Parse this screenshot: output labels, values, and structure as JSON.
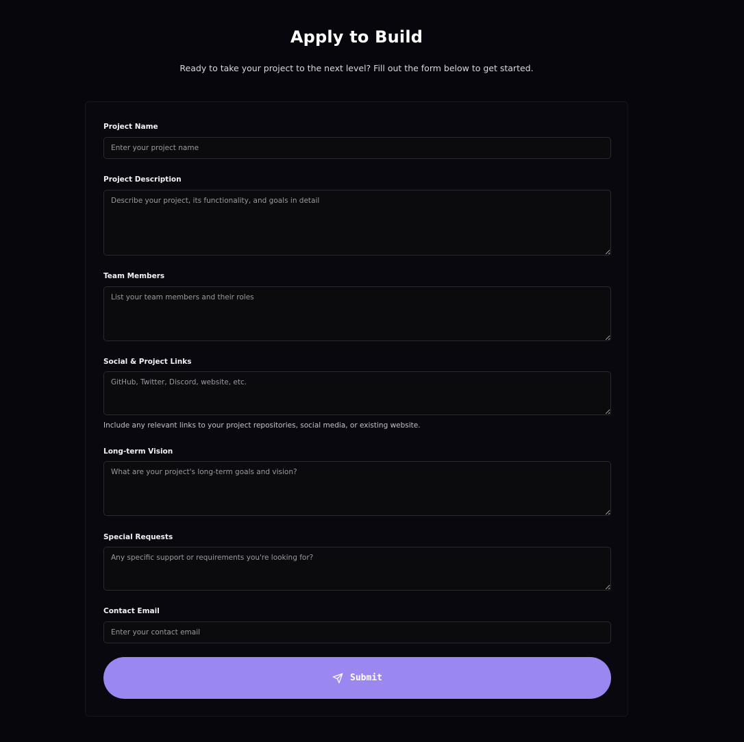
{
  "header": {
    "title": "Apply to Build",
    "subtitle": "Ready to take your project to the next level? Fill out the form below to get started."
  },
  "form": {
    "project_name": {
      "label": "Project Name",
      "placeholder": "Enter your project name"
    },
    "project_description": {
      "label": "Project Description",
      "placeholder": "Describe your project, its functionality, and goals in detail"
    },
    "team_members": {
      "label": "Team Members",
      "placeholder": "List your team members and their roles"
    },
    "social_links": {
      "label": "Social & Project Links",
      "placeholder": "GitHub, Twitter, Discord, website, etc.",
      "help": "Include any relevant links to your project repositories, social media, or existing website."
    },
    "long_term_vision": {
      "label": "Long-term Vision",
      "placeholder": "What are your project's long-term goals and vision?"
    },
    "special_requests": {
      "label": "Special Requests",
      "placeholder": "Any specific support or requirements you're looking for?"
    },
    "contact_email": {
      "label": "Contact Email",
      "placeholder": "Enter your contact email"
    },
    "submit": {
      "label": "Submit",
      "icon": "send-icon"
    }
  },
  "colors": {
    "background": "#07060c",
    "card": "#09080e",
    "accent": "#9b87f0"
  }
}
